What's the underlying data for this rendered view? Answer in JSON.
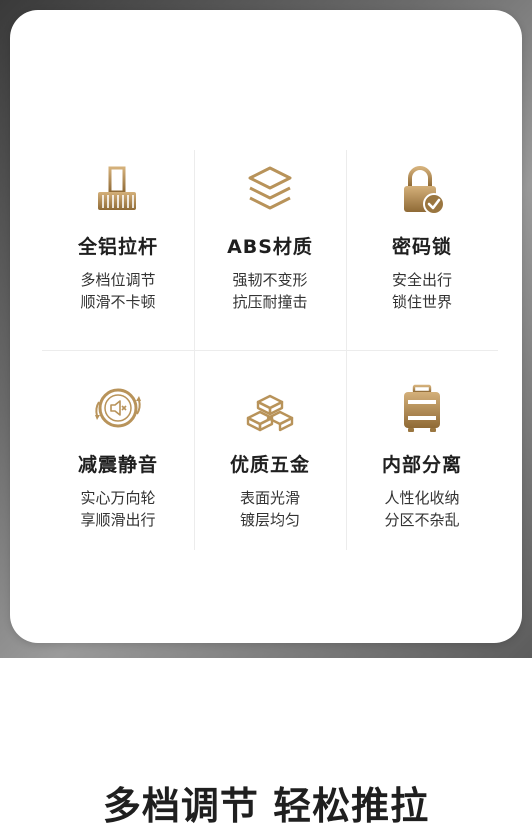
{
  "features": [
    {
      "icon": "telescopic-handle-icon",
      "title": "全铝拉杆",
      "lines": [
        "多档位调节",
        "顺滑不卡顿"
      ]
    },
    {
      "icon": "layers-icon",
      "title": "ABS材质",
      "lines": [
        "强韧不变形",
        "抗压耐撞击"
      ]
    },
    {
      "icon": "padlock-icon",
      "title": "密码锁",
      "lines": [
        "安全出行",
        "锁住世界"
      ]
    },
    {
      "icon": "silent-wheel-icon",
      "title": "减震静音",
      "lines": [
        "实心万向轮",
        "享顺滑出行"
      ]
    },
    {
      "icon": "metal-bars-icon",
      "title": "优质五金",
      "lines": [
        "表面光滑",
        "镀层均匀"
      ]
    },
    {
      "icon": "suitcase-icon",
      "title": "内部分离",
      "lines": [
        "人性化收纳",
        "分区不杂乱"
      ]
    }
  ],
  "headline": "多档调节 轻松推拉",
  "colors": {
    "accent_gold": "#b8935a",
    "text_dark": "#1f1f1f"
  }
}
